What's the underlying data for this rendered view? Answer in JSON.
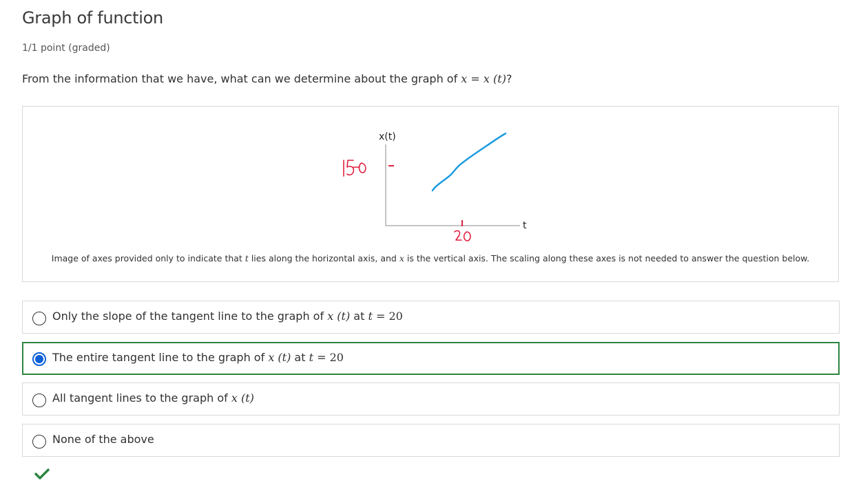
{
  "problem": {
    "title": "Graph of function",
    "points": "1/1 point (graded)",
    "question_prefix": "From the information that we have, what can we determine about the graph of ",
    "question_math_var": "x",
    "question_math_eq": " = ",
    "question_math_fn": "x",
    "question_math_arg": " (t)",
    "question_suffix": "?"
  },
  "figure": {
    "y_axis_label": "x(t)",
    "x_axis_label": "t",
    "y_handwritten": "150",
    "x_handwritten": "20",
    "curve_color": "#1a9be0",
    "annotation_color": "#e01f3d",
    "caption_part1": "Image of axes provided only to indicate that ",
    "caption_var_t": "t",
    "caption_part2": " lies along the horizontal axis, and ",
    "caption_var_x": "x",
    "caption_part3": " is the vertical axis. The scaling along these axes is not needed to answer the question below."
  },
  "options": [
    {
      "text": "Only the slope of the tangent line to the graph of ",
      "math_fn": "x",
      "math_arg": " (t)",
      "tail_text": " at ",
      "tail_var": "t",
      "tail_eq": " = 20",
      "selected": false
    },
    {
      "text": "The entire tangent line to the graph of ",
      "math_fn": "x",
      "math_arg": " (t)",
      "tail_text": " at ",
      "tail_var": "t",
      "tail_eq": " = 20",
      "selected": true
    },
    {
      "text": "All tangent lines to the graph of ",
      "math_fn": "x",
      "math_arg": " (t)",
      "selected": false
    },
    {
      "text": "None of the above",
      "selected": false
    }
  ],
  "status": {
    "icon": "checkmark-icon",
    "color": "#2e8540",
    "correct": true
  }
}
